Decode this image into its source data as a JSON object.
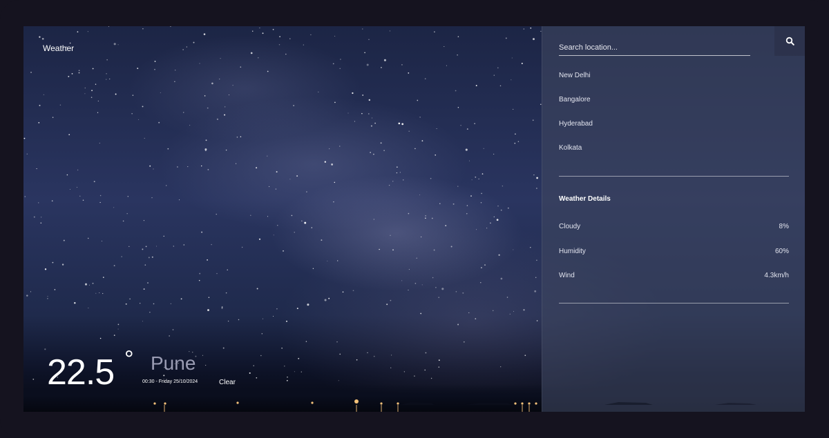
{
  "app": {
    "title": "Weather"
  },
  "current": {
    "temperature": "22.5",
    "degree_symbol": "°",
    "city": "Pune",
    "datetime": "00:30 - Friday 25/10/2024",
    "condition": "Clear",
    "condition_icon": "crescent-moon-icon"
  },
  "search": {
    "placeholder": "Search location...",
    "button_icon": "search-icon"
  },
  "locations": [
    "New Delhi",
    "Bangalore",
    "Hyderabad",
    "Kolkata"
  ],
  "details": {
    "title": "Weather Details",
    "rows": [
      {
        "label": "Cloudy",
        "value": "8%"
      },
      {
        "label": "Humidity",
        "value": "60%"
      },
      {
        "label": "Wind",
        "value": "4.3km/h"
      }
    ]
  },
  "colors": {
    "frame": "#15131f",
    "sky_top": "#1c2545",
    "panel": "#3e4660",
    "city_text": "#9a9cb3",
    "text": "#ffffff"
  }
}
